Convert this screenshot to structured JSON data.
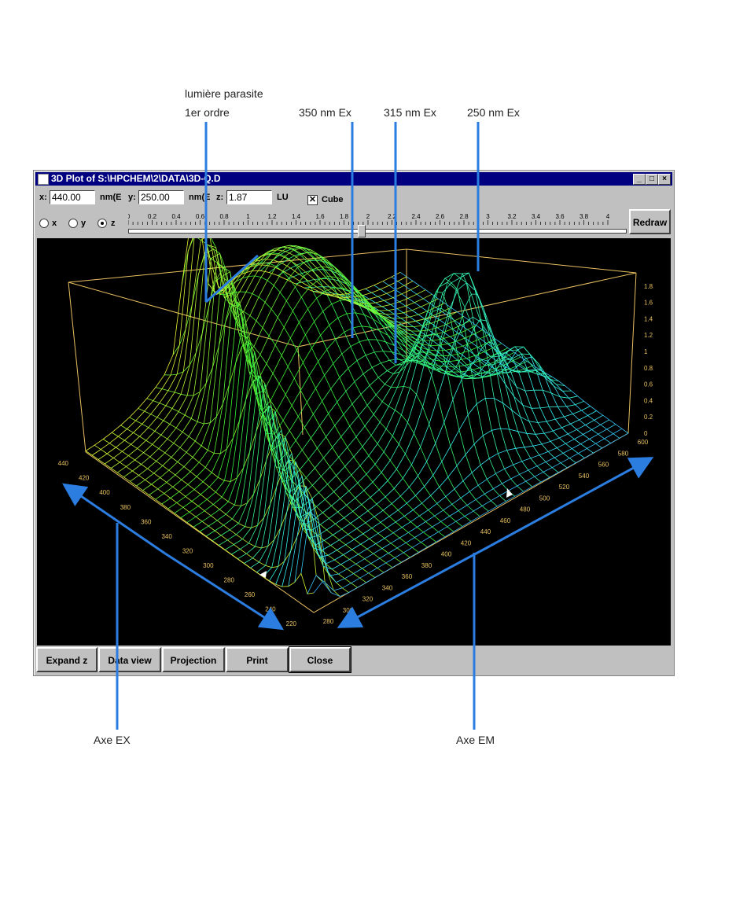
{
  "callouts": {
    "stray_light_1": "lumière parasite",
    "stray_light_2": "1er ordre",
    "ex350": "350 nm Ex",
    "ex315": "315 nm Ex",
    "ex250": "250 nm Ex",
    "axe_ex": "Axe EX",
    "axe_em": "Axe EM"
  },
  "window": {
    "title": "3D Plot of S:\\HPCHEM\\2\\DATA\\3D-Q.D",
    "controls": [
      "_",
      "□",
      "×"
    ]
  },
  "toolbar": {
    "x_label": "x:",
    "x_value": "440.00",
    "x_unit": "nm(E",
    "y_label": "y:",
    "y_value": "250.00",
    "y_unit": "nm(E",
    "z_label": "z:",
    "z_value": "1.87",
    "z_unit": "LU",
    "cube_label": "Cube",
    "cube_checked": "✕",
    "radio_x": "x",
    "radio_y": "y",
    "radio_z": "z",
    "redraw": "Redraw"
  },
  "ruler_ticks": [
    "0",
    "0.2",
    "0.4",
    "0.6",
    "0.8",
    "1",
    "1.2",
    "1.4",
    "1.6",
    "1.8",
    "2",
    "2.2",
    "2.4",
    "2.6",
    "2.8",
    "3",
    "3.2",
    "3.4",
    "3.6",
    "3.8",
    "4"
  ],
  "slider_value": 1.87,
  "buttons": {
    "expand_z": "Expand z",
    "data_view": "Data view",
    "projection": "Projection",
    "print": "Print",
    "close": "Close"
  },
  "plot_axes": {
    "ex_ticks": [
      "440",
      "420",
      "400",
      "380",
      "360",
      "340",
      "320",
      "300",
      "280",
      "260",
      "240",
      "220"
    ],
    "em_ticks": [
      "280",
      "300",
      "320",
      "340",
      "360",
      "380",
      "400",
      "420",
      "440",
      "460",
      "480",
      "500",
      "520",
      "540",
      "560",
      "580",
      "600"
    ],
    "z_ticks": [
      "0",
      "0.2",
      "0.4",
      "0.6",
      "0.8",
      "1",
      "1.2",
      "1.4",
      "1.6",
      "1.8"
    ]
  },
  "colors": {
    "titlebar": "#000080",
    "arrow": "#2b7de0",
    "frame": "#e8c060"
  }
}
